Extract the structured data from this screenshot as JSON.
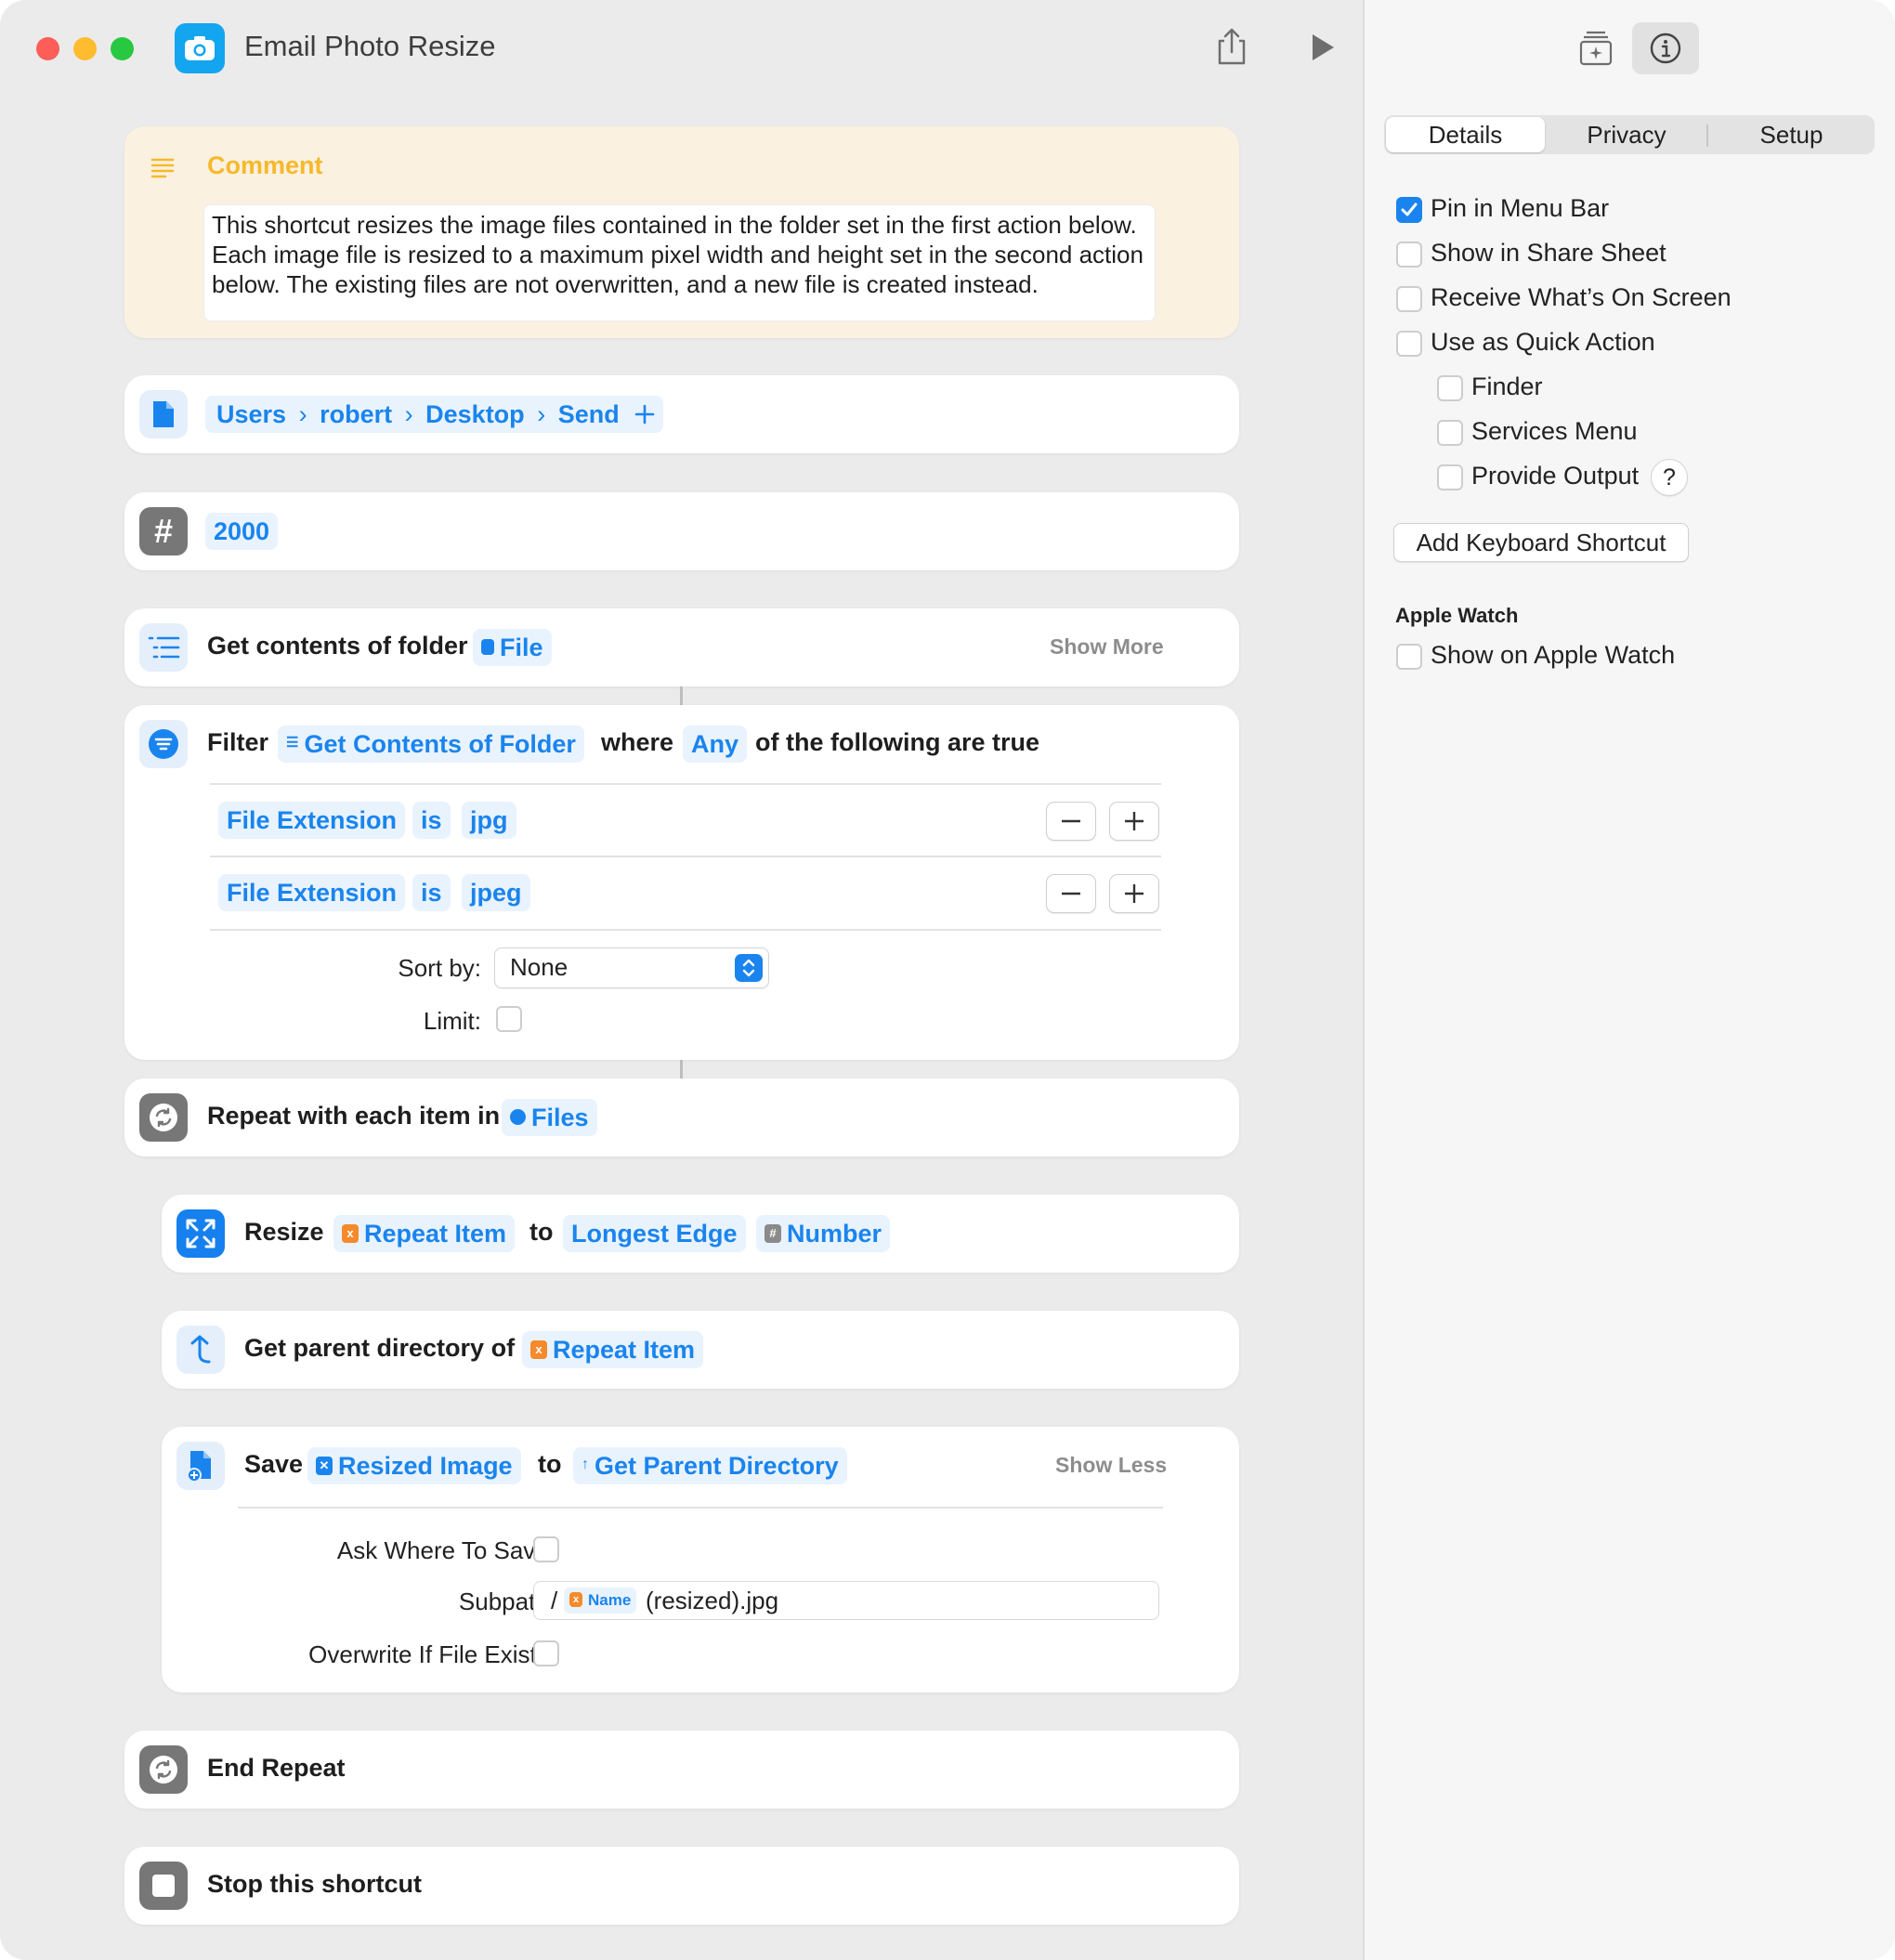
{
  "window": {
    "title": "Email Photo Resize",
    "traffic_colors": [
      "#fd5e57",
      "#febc2e",
      "#28c840"
    ]
  },
  "comment": {
    "label": "Comment",
    "text": "This shortcut resizes the image files contained in the folder set in the first action below. Each image file is resized to a maximum pixel width and height set in the second action below. The existing files are not overwritten, and a new file is created instead."
  },
  "folder_path": {
    "segments": [
      "Users",
      "robert",
      "Desktop",
      "Send"
    ]
  },
  "number_action": {
    "value": "2000"
  },
  "get_contents": {
    "label": "Get contents of folder",
    "token": "File",
    "show_more": "Show More"
  },
  "filter": {
    "label": "Filter",
    "source_token": "Get Contents of Folder",
    "where": "where",
    "any": "Any",
    "suffix": "of the following are true",
    "conditions": [
      {
        "field": "File Extension",
        "op": "is",
        "value": "jpg"
      },
      {
        "field": "File Extension",
        "op": "is",
        "value": "jpeg"
      }
    ],
    "sort_label": "Sort by:",
    "sort_value": "None",
    "limit_label": "Limit:"
  },
  "repeat": {
    "label": "Repeat with each item in",
    "token": "Files"
  },
  "resize": {
    "label": "Resize",
    "item_token": "Repeat Item",
    "to": "to",
    "edge_token": "Longest Edge",
    "number_token": "Number"
  },
  "parent_dir": {
    "label": "Get parent directory of",
    "token": "Repeat Item"
  },
  "save": {
    "label": "Save",
    "image_token": "Resized Image",
    "to": "to",
    "dir_token": "Get Parent Directory",
    "show_less": "Show Less",
    "ask_label": "Ask Where To Save:",
    "subpath_label": "Subpath:",
    "subpath_prefix": "/",
    "subpath_token": "Name",
    "subpath_suffix": "(resized).jpg",
    "overwrite_label": "Overwrite If File Exists:"
  },
  "end_repeat": {
    "label": "End Repeat"
  },
  "stop": {
    "label": "Stop this shortcut"
  },
  "sidebar": {
    "tabs": [
      "Details",
      "Privacy",
      "Setup"
    ],
    "selected_tab": "Details",
    "options": [
      {
        "label": "Pin in Menu Bar",
        "checked": true
      },
      {
        "label": "Show in Share Sheet",
        "checked": false
      },
      {
        "label": "Receive What’s On Screen",
        "checked": false
      },
      {
        "label": "Use as Quick Action",
        "checked": false
      }
    ],
    "quick_action_sub": [
      {
        "label": "Finder",
        "checked": false
      },
      {
        "label": "Services Menu",
        "checked": false
      },
      {
        "label": "Provide Output",
        "checked": false
      }
    ],
    "help": "?",
    "keyboard_button": "Add Keyboard Shortcut",
    "watch_heading": "Apple Watch",
    "watch_option": {
      "label": "Show on Apple Watch",
      "checked": false
    }
  },
  "colors": {
    "accent": "#1a84ee",
    "comment_bg": "#fbf1e1",
    "comment_accent": "#f6b92b",
    "token_bg": "#e9f3fd",
    "magic_orange": "#f58a2c"
  },
  "icons": [
    "camera-icon",
    "share-icon",
    "play-icon",
    "library-icon",
    "info-icon",
    "document-icon",
    "hash-icon",
    "list-icon",
    "filter-icon",
    "repeat-icon",
    "resize-icon",
    "parent-directory-icon",
    "save-file-icon",
    "stop-icon"
  ]
}
